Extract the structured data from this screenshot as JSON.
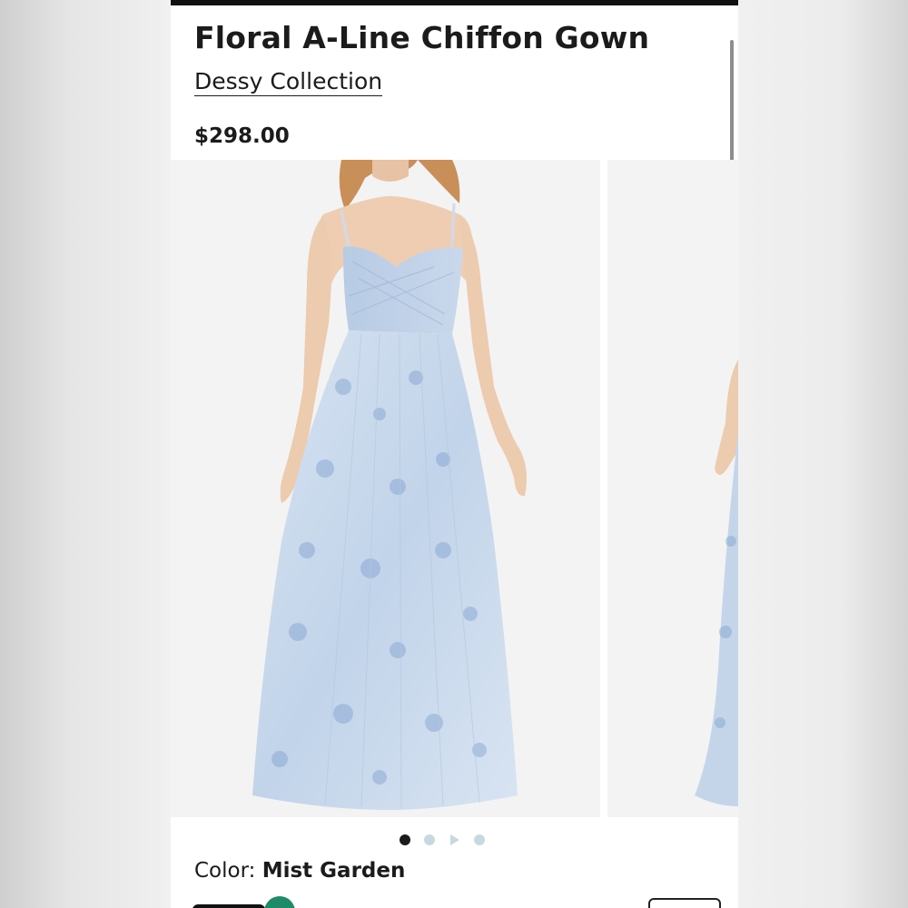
{
  "product": {
    "title": "Floral A-Line Chiffon Gown",
    "brand": "Dessy Collection",
    "price": "$298.00"
  },
  "gallery": {
    "slides": [
      {
        "image": "floral-blue-gown-front"
      },
      {
        "image": "floral-blue-gown-side"
      }
    ],
    "indicator": [
      "active-dot",
      "dot",
      "video-play-icon",
      "dot"
    ]
  },
  "color": {
    "label": "Color: ",
    "value": "Mist Garden"
  },
  "colors": {
    "text": "#1b1b1b",
    "selected_swatch_check": "#1e8a68",
    "dress_blue": "#b9cde4",
    "indicator_inactive": "#c7d9df"
  }
}
